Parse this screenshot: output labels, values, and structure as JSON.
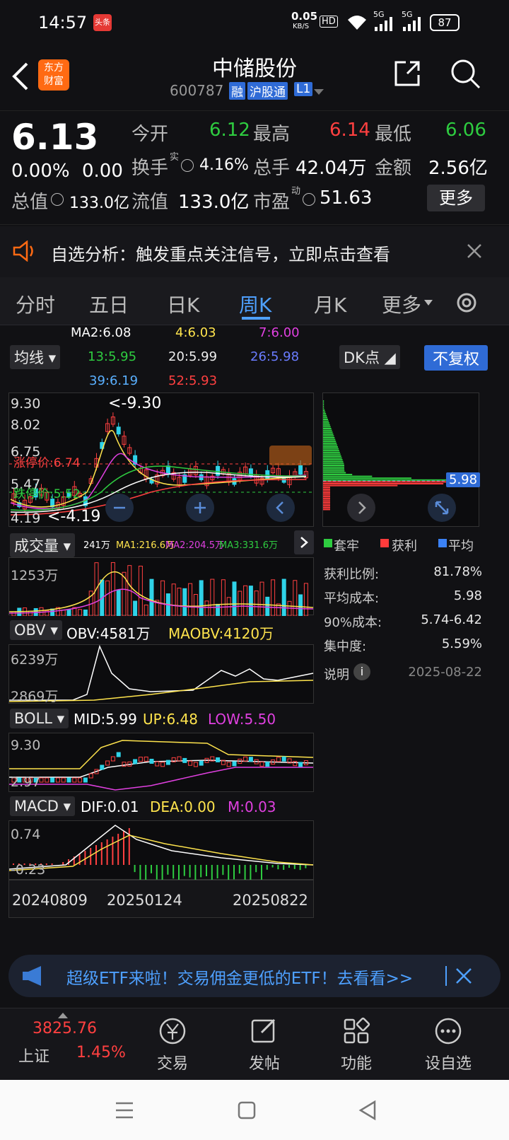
{
  "status": {
    "time": "14:57",
    "app_badge": "头条",
    "net_speed": "0.05",
    "net_unit": "KB/S",
    "hd": "HD",
    "sig1": "5G",
    "sig2": "5G",
    "battery": "87"
  },
  "header": {
    "logo_line1": "东方",
    "logo_line2": "财富",
    "stock_name": "中储股份",
    "stock_code": "600787",
    "tag_rong": "融",
    "tag_hgt": "沪股通",
    "tag_level": "L1"
  },
  "quote": {
    "price": "6.13",
    "change_pct": "0.00%",
    "change": "0.00",
    "open_label": "今开",
    "open": "6.12",
    "high_label": "最高",
    "high": "6.14",
    "low_label": "最低",
    "low": "6.06",
    "turnover_label": "换手",
    "turnover_sup": "实",
    "turnover": "4.16%",
    "volume_label": "总手",
    "volume": "42.04万",
    "amount_label": "金额",
    "amount": "2.56亿",
    "mktcap_label": "总值",
    "mktcap": "133.0亿",
    "float_label": "流值",
    "float_cap": "133.0亿",
    "pe_label": "市盈",
    "pe_sup": "动",
    "pe": "51.63",
    "more_label": "更多"
  },
  "alert": {
    "text": "自选分析：触发重点关注信号，立即点击查看"
  },
  "tabs": [
    "分时",
    "五日",
    "日K",
    "周K",
    "月K",
    "更多"
  ],
  "ma": {
    "ma2": "MA2:6.08",
    "ma4": "4:6.03",
    "ma7": "7:6.00",
    "ma13": "13:5.95",
    "ma20": "20:5.99",
    "ma26": "26:5.98",
    "ma39": "39:6.19",
    "ma52": "52:5.93",
    "type_label": "均线",
    "dk_label": "DK点",
    "adjust_label": "不复权"
  },
  "kchart": {
    "y_top": "9.30",
    "y_2": "8.02",
    "y_3": "6.75",
    "y_4": "5.47",
    "y_low": "4.19",
    "max_note": "<-9.30",
    "min_note": "<-4.19",
    "limit_up": "涨停价:6.74",
    "limit_down": "跌停价:5.52",
    "pill": "5.98"
  },
  "volume": {
    "label": "成交量",
    "v": "241万",
    "ma1": "MA1:216.6万",
    "ma2": "MA2:204.5万",
    "ma3": "MA3:331.6万",
    "y": "1253万"
  },
  "legend": {
    "trapped": "套牢",
    "profit": "获利",
    "avg": "平均",
    "trapped_color": "#2ecc40",
    "profit_color": "#ff3b3b",
    "avg_color": "#3b82f6"
  },
  "chips": {
    "profit_ratio_label": "获利比例:",
    "profit_ratio": "81.78%",
    "avg_cost_label": "平均成本:",
    "avg_cost": "5.98",
    "cost90_label": "90%成本:",
    "cost90": "5.74-6.42",
    "concentration_label": "集中度:",
    "concentration": "5.59%",
    "explain_label": "说明",
    "date": "2025-08-22"
  },
  "obv": {
    "label": "OBV",
    "obv": "OBV:4581万",
    "maobv": "MAOBV:4120万",
    "y1": "6239万",
    "y2": "2869万"
  },
  "boll": {
    "label": "BOLL",
    "mid": "MID:5.99",
    "up": "UP:6.48",
    "low": "LOW:5.50",
    "y1": "9.30",
    "y2": "2.97"
  },
  "macd": {
    "label": "MACD",
    "dif": "DIF:0.01",
    "dea": "DEA:0.00",
    "m": "M:0.03",
    "y1": "0.74",
    "y2": "-0.23"
  },
  "xaxis": {
    "d1": "20240809",
    "d2": "20250124",
    "d3": "20250822"
  },
  "banner": {
    "text": "超级ETF来啦！交易佣金更低的ETF！去看看>>"
  },
  "bottom": {
    "index_value": "3825.76",
    "index_name": "上证",
    "index_change": "1.45%",
    "trade": "交易",
    "post": "发帖",
    "func": "功能",
    "watch": "设自选"
  }
}
